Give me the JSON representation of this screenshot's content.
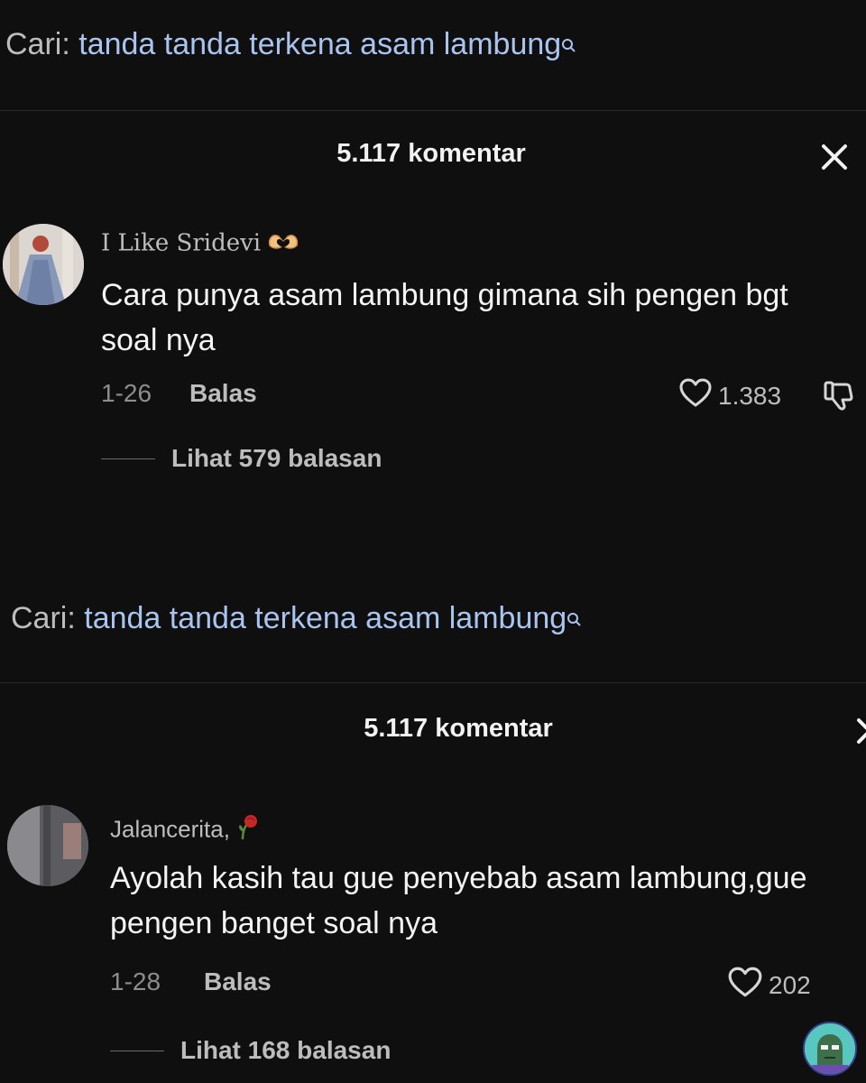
{
  "screens": [
    {
      "search": {
        "prefix": "Cari:",
        "query": "tanda tanda terkena asam lambung"
      },
      "comment_count": "5.117 komentar",
      "comment": {
        "username": "I Like Sridevi",
        "text": "Cara punya asam lambung gimana sih pengen bgt soal nya",
        "date": "1-26",
        "reply_label": "Balas",
        "likes": "1.383",
        "view_replies": "Lihat 579 balasan"
      }
    },
    {
      "search": {
        "prefix": "Cari:",
        "query": "tanda tanda terkena asam lambung"
      },
      "comment_count": "5.117 komentar",
      "comment": {
        "username": "Jalancerita,",
        "text": "Ayolah kasih tau gue penyebab asam lambung,gue pengen banget soal nya",
        "date": "1-28",
        "reply_label": "Balas",
        "likes": "202",
        "view_replies": "Lihat 168 balasan"
      }
    }
  ],
  "colors": {
    "background": "#0f0f10",
    "query": "#a9c4ee",
    "muted": "#bdbdbd"
  },
  "icons": [
    "search-icon",
    "close-icon",
    "heart-icon",
    "dislike-icon",
    "heart-hands-emoji",
    "wilted-rose-emoji"
  ]
}
